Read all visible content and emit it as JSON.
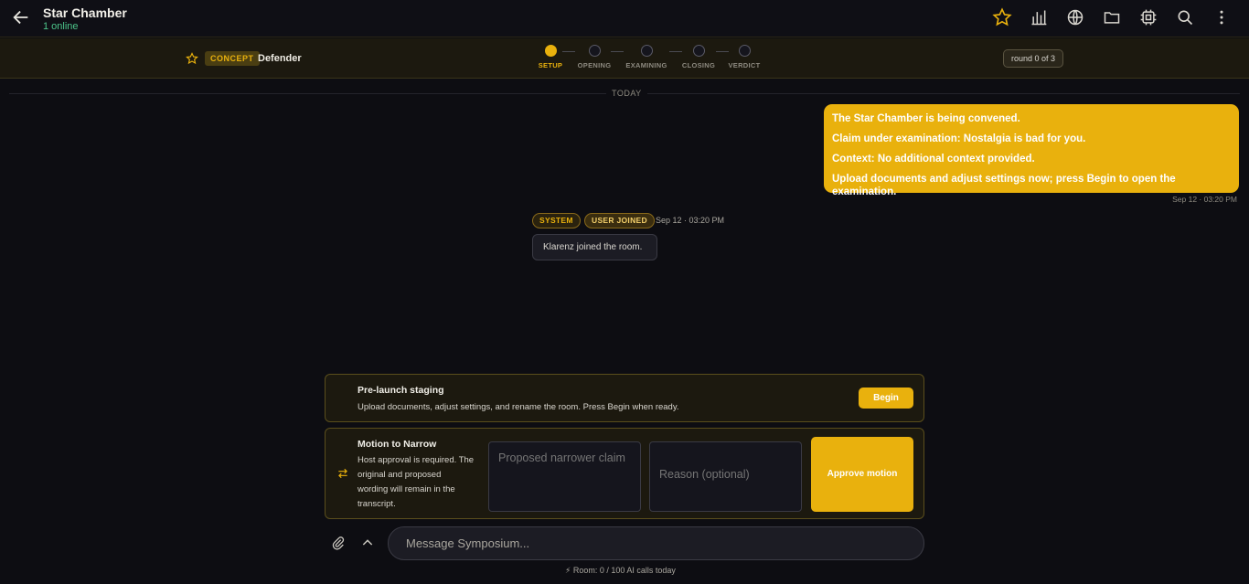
{
  "header": {
    "title": "Star Chamber",
    "online": "1 online"
  },
  "stage_bar": {
    "tag": "CONCEPT",
    "role": "Defender",
    "steps": [
      "SETUP",
      "OPENING",
      "EXAMINING",
      "CLOSING",
      "VERDICT"
    ],
    "active_step": 0,
    "round": "round 0 of 3"
  },
  "divider": "TODAY",
  "message": {
    "lines": [
      "The Star Chamber is being convened.",
      "Claim under examination: Nostalgia is bad for you.",
      "Context: No additional context provided.",
      "Upload documents and adjust settings now; press Begin to open the examination."
    ],
    "time": "Sep 12 · 03:20 PM"
  },
  "system_event": {
    "badge_system": "SYSTEM",
    "badge_event": "USER JOINED",
    "time": "Sep 12 · 03:20 PM",
    "text": "Klarenz joined the room."
  },
  "staging": {
    "title": "Pre-launch staging",
    "text": "Upload documents, adjust settings, and rename the room. Press Begin when ready.",
    "button": "Begin"
  },
  "motion": {
    "title": "Motion to Narrow",
    "text_lines": [
      "Host approval is required. The",
      "original and proposed",
      "wording will remain in the",
      "transcript."
    ],
    "claim_placeholder": "Proposed narrower claim",
    "reason_placeholder": "Reason (optional)",
    "button": "Approve motion"
  },
  "composer": {
    "placeholder": "Message Symposium..."
  },
  "footer": "Room: 0 / 100 AI calls today",
  "colors": {
    "accent": "#e9b10d",
    "online": "#4cc58a",
    "bg": "#0d0d12"
  }
}
